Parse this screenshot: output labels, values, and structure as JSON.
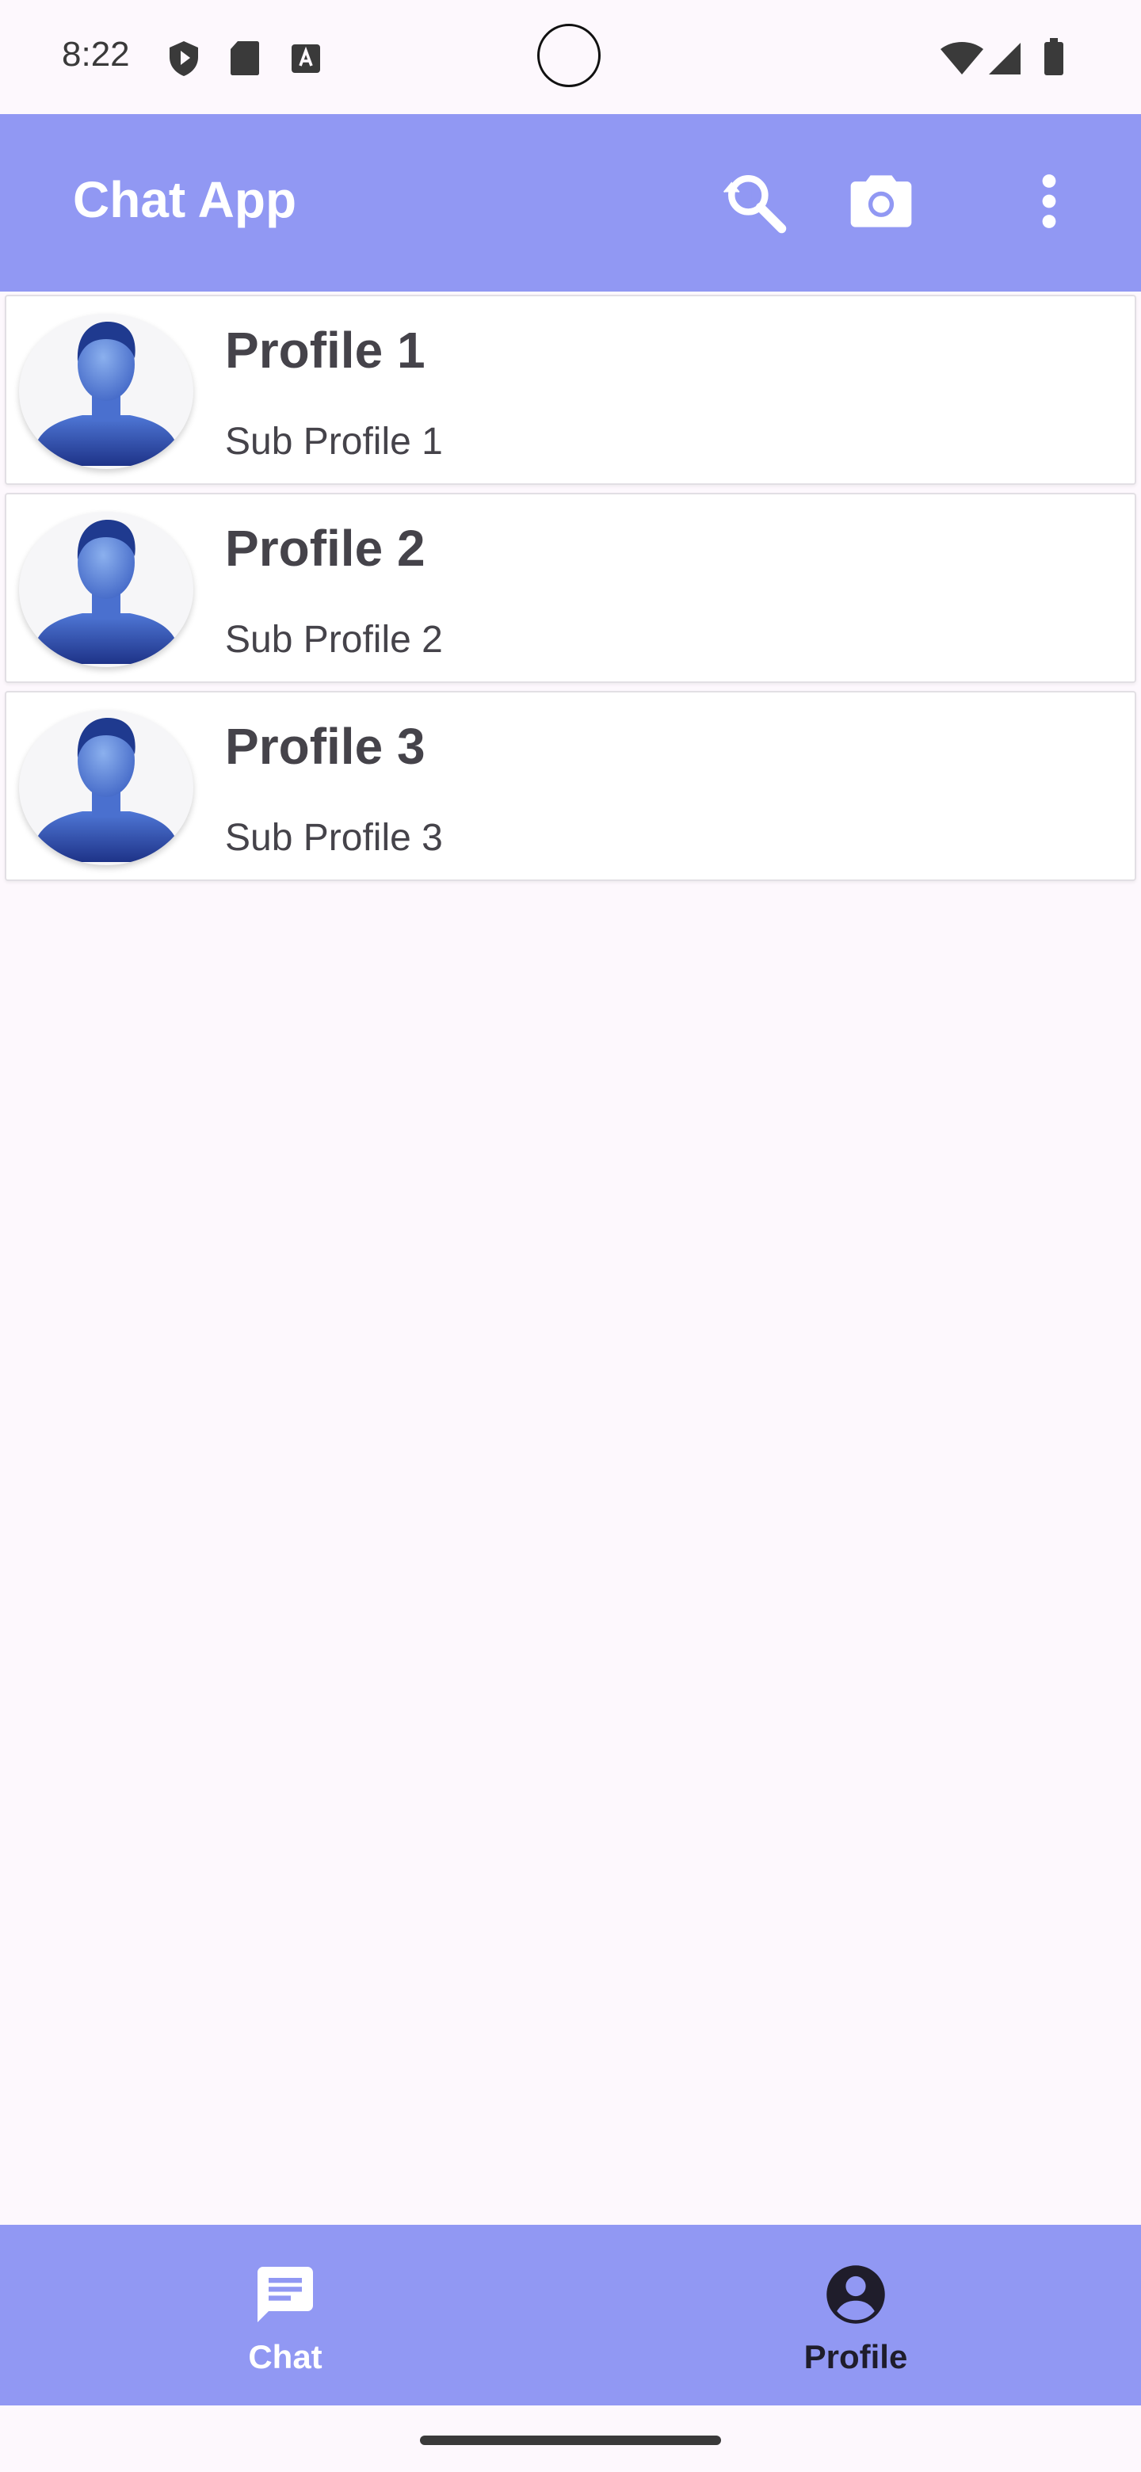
{
  "status_bar": {
    "time": "8:22",
    "icons_left": [
      "shield-icon",
      "sd-card-icon",
      "keyboard-a-icon"
    ],
    "icons_right": [
      "wifi-icon",
      "cell-signal-icon",
      "battery-icon"
    ]
  },
  "app_bar": {
    "title": "Chat App",
    "actions": [
      "search-refresh-icon",
      "camera-icon",
      "more-vert-icon"
    ],
    "color": "#9198f3"
  },
  "profiles": [
    {
      "name": "Profile 1",
      "subtitle": "Sub Profile 1"
    },
    {
      "name": "Profile 2",
      "subtitle": "Sub Profile 2"
    },
    {
      "name": "Profile 3",
      "subtitle": "Sub Profile 3"
    }
  ],
  "bottom_nav": {
    "items": [
      {
        "label": "Chat",
        "icon": "chat-icon",
        "selected": true
      },
      {
        "label": "Profile",
        "icon": "account-circle-icon",
        "selected": false
      }
    ],
    "selected_color": "#ffffff",
    "unselected_color": "#1f1d2b"
  }
}
